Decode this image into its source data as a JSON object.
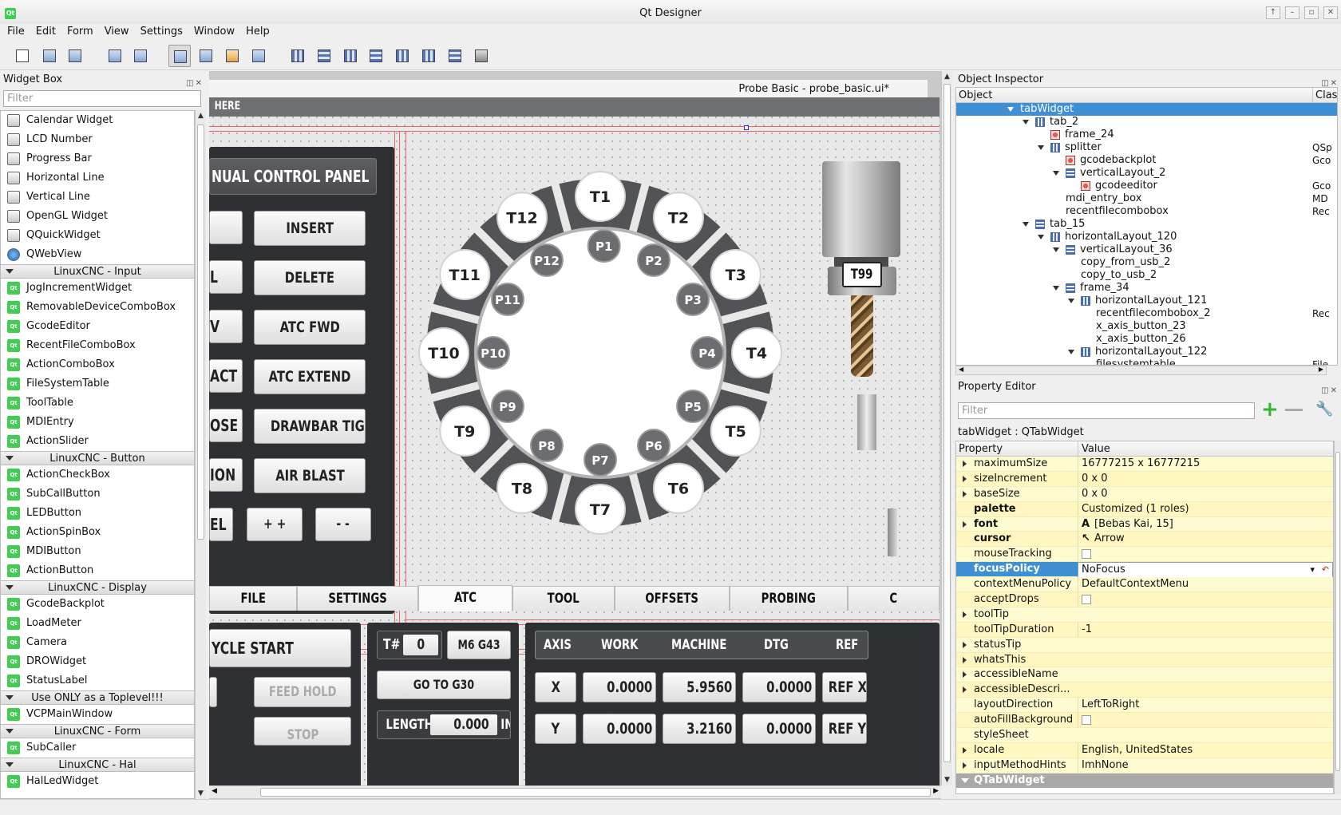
{
  "window": {
    "title": "Qt Designer"
  },
  "menu": [
    "File",
    "Edit",
    "Form",
    "View",
    "Settings",
    "Window",
    "Help"
  ],
  "widget_box": {
    "title": "Widget Box",
    "filter_placeholder": "Filter",
    "entries": [
      {
        "type": "item",
        "label": "Calendar Widget",
        "icon": "calendar-icon"
      },
      {
        "type": "item",
        "label": "LCD Number",
        "icon": "lcd-icon"
      },
      {
        "type": "item",
        "label": "Progress Bar",
        "icon": "progress-bar-icon"
      },
      {
        "type": "item",
        "label": "Horizontal Line",
        "icon": "horizontal-line-icon"
      },
      {
        "type": "item",
        "label": "Vertical Line",
        "icon": "vertical-line-icon"
      },
      {
        "type": "item",
        "label": "OpenGL Widget",
        "icon": "opengl-icon"
      },
      {
        "type": "item",
        "label": "QQuickWidget",
        "icon": "quick-widget-icon"
      },
      {
        "type": "item",
        "label": "QWebView",
        "icon": "globe-icon"
      },
      {
        "type": "category",
        "label": "LinuxCNC - Input"
      },
      {
        "type": "item",
        "label": "JogIncrementWidget",
        "icon": "qt-icon"
      },
      {
        "type": "item",
        "label": "RemovableDeviceComboBox",
        "icon": "qt-icon"
      },
      {
        "type": "item",
        "label": "GcodeEditor",
        "icon": "qt-icon"
      },
      {
        "type": "item",
        "label": "RecentFileComboBox",
        "icon": "qt-icon"
      },
      {
        "type": "item",
        "label": "ActionComboBox",
        "icon": "qt-icon"
      },
      {
        "type": "item",
        "label": "FileSystemTable",
        "icon": "qt-icon"
      },
      {
        "type": "item",
        "label": "ToolTable",
        "icon": "qt-icon"
      },
      {
        "type": "item",
        "label": "MDIEntry",
        "icon": "qt-icon"
      },
      {
        "type": "item",
        "label": "ActionSlider",
        "icon": "qt-icon"
      },
      {
        "type": "category",
        "label": "LinuxCNC - Button"
      },
      {
        "type": "item",
        "label": "ActionCheckBox",
        "icon": "qt-icon"
      },
      {
        "type": "item",
        "label": "SubCallButton",
        "icon": "qt-icon"
      },
      {
        "type": "item",
        "label": "LEDButton",
        "icon": "qt-icon"
      },
      {
        "type": "item",
        "label": "ActionSpinBox",
        "icon": "qt-icon"
      },
      {
        "type": "item",
        "label": "MDIButton",
        "icon": "qt-icon"
      },
      {
        "type": "item",
        "label": "ActionButton",
        "icon": "qt-icon"
      },
      {
        "type": "category",
        "label": "LinuxCNC - Display"
      },
      {
        "type": "item",
        "label": "GcodeBackplot",
        "icon": "qt-icon"
      },
      {
        "type": "item",
        "label": "LoadMeter",
        "icon": "qt-icon"
      },
      {
        "type": "item",
        "label": "Camera",
        "icon": "qt-icon"
      },
      {
        "type": "item",
        "label": "DROWidget",
        "icon": "qt-icon"
      },
      {
        "type": "item",
        "label": "StatusLabel",
        "icon": "qt-icon"
      },
      {
        "type": "category",
        "label": "Use ONLY as a Toplevel!!!"
      },
      {
        "type": "item",
        "label": "VCPMainWindow",
        "icon": "qt-icon"
      },
      {
        "type": "category",
        "label": "LinuxCNC - Form"
      },
      {
        "type": "item",
        "label": "SubCaller",
        "icon": "qt-icon"
      },
      {
        "type": "category",
        "label": "LinuxCNC - Hal"
      },
      {
        "type": "item",
        "label": "HalLedWidget",
        "icon": "qt-icon"
      }
    ]
  },
  "form": {
    "title": "Probe Basic - probe_basic.ui*",
    "header_strip": "HERE",
    "manual_panel_title": "NUAL CONTROL PANEL",
    "left_buttons": [
      "",
      "L",
      "V",
      "ACT",
      "OSE",
      "ION",
      "EL"
    ],
    "right_buttons": [
      "INSERT",
      "DELETE",
      "ATC FWD",
      "ATC EXTEND",
      "DRAWBAR TIGHT",
      "AIR BLAST"
    ],
    "small_buttons": [
      "+ +",
      "- -"
    ],
    "carousel_outer": [
      "T1",
      "T2",
      "T3",
      "T4",
      "T5",
      "T6",
      "T7",
      "T8",
      "T9",
      "T10",
      "T11",
      "T12"
    ],
    "carousel_inner": [
      "P1",
      "P2",
      "P3",
      "P4",
      "P5",
      "P6",
      "P7",
      "P8",
      "P9",
      "P10",
      "P11",
      "P12"
    ],
    "spindle_tool": "T99",
    "tabs": [
      "FILE",
      "SETTINGS",
      "ATC",
      "TOOL",
      "OFFSETS",
      "PROBING",
      "C"
    ],
    "selected_tab": "ATC",
    "cycle_start": "YCLE START",
    "feed_hold": "FEED HOLD",
    "stop": "STOP",
    "tool_hash_label": "T#",
    "tool_number": "0",
    "m6_g43": "M6 G43",
    "go_to_g30": "GO TO G30",
    "length_label": "LENGTH",
    "length_value": "0.000",
    "length_unit": "IN",
    "dro_headers": [
      "AXIS",
      "WORK",
      "MACHINE",
      "DTG",
      "REF"
    ],
    "dro_rows": [
      {
        "axis": "X",
        "work": "0.0000",
        "machine": "5.9560",
        "dtg": "0.0000",
        "ref": "REF X"
      },
      {
        "axis": "Y",
        "work": "0.0000",
        "machine": "3.2160",
        "dtg": "0.0000",
        "ref": "REF Y"
      }
    ]
  },
  "object_inspector": {
    "title": "Object Inspector",
    "col_object": "Object",
    "col_class": "Clas",
    "rows": [
      {
        "name": "tabWidget",
        "cls": "",
        "depth": 0,
        "exp": true,
        "sel": true,
        "icon": "tab"
      },
      {
        "name": "tab_2",
        "cls": "",
        "depth": 1,
        "exp": true,
        "icon": "h"
      },
      {
        "name": "frame_24",
        "cls": "",
        "depth": 2,
        "exp": false,
        "icon": "w"
      },
      {
        "name": "splitter",
        "cls": "QSp",
        "depth": 2,
        "exp": true,
        "icon": "h"
      },
      {
        "name": "gcodebackplot",
        "cls": "Gco",
        "depth": 3,
        "exp": false,
        "icon": "w"
      },
      {
        "name": "verticalLayout_2",
        "cls": "",
        "depth": 3,
        "exp": true,
        "icon": "v"
      },
      {
        "name": "gcodeeditor",
        "cls": "Gco",
        "depth": 4,
        "exp": false,
        "icon": "w"
      },
      {
        "name": "mdi_entry_box",
        "cls": "MD",
        "depth": 3,
        "exp": false,
        "icon": ""
      },
      {
        "name": "recentfilecombobox",
        "cls": "Rec",
        "depth": 3,
        "exp": false,
        "icon": ""
      },
      {
        "name": "tab_15",
        "cls": "",
        "depth": 1,
        "exp": true,
        "icon": "v"
      },
      {
        "name": "horizontalLayout_120",
        "cls": "",
        "depth": 2,
        "exp": true,
        "icon": "h"
      },
      {
        "name": "verticalLayout_36",
        "cls": "",
        "depth": 3,
        "exp": true,
        "icon": "v"
      },
      {
        "name": "copy_from_usb_2",
        "cls": "",
        "depth": 4,
        "exp": false,
        "icon": ""
      },
      {
        "name": "copy_to_usb_2",
        "cls": "",
        "depth": 4,
        "exp": false,
        "icon": ""
      },
      {
        "name": "frame_34",
        "cls": "",
        "depth": 3,
        "exp": true,
        "icon": "v"
      },
      {
        "name": "horizontalLayout_121",
        "cls": "",
        "depth": 4,
        "exp": true,
        "icon": "h"
      },
      {
        "name": "recentfilecombobox_2",
        "cls": "Rec",
        "depth": 5,
        "exp": false,
        "icon": ""
      },
      {
        "name": "x_axis_button_23",
        "cls": "",
        "depth": 5,
        "exp": false,
        "icon": ""
      },
      {
        "name": "x_axis_button_26",
        "cls": "",
        "depth": 5,
        "exp": false,
        "icon": ""
      },
      {
        "name": "horizontalLayout_122",
        "cls": "",
        "depth": 4,
        "exp": true,
        "icon": "h"
      },
      {
        "name": "filesystemtable",
        "cls": "File",
        "depth": 5,
        "exp": false,
        "icon": ""
      }
    ]
  },
  "property_editor": {
    "title": "Property Editor",
    "filter_placeholder": "Filter",
    "object_class": "tabWidget : QTabWidget",
    "col_property": "Property",
    "col_value": "Value",
    "rows": [
      {
        "name": "maximumSize",
        "value": "16777215 x 16777215",
        "expand": true
      },
      {
        "name": "sizeIncrement",
        "value": "0 x 0",
        "expand": true
      },
      {
        "name": "baseSize",
        "value": "0 x 0",
        "expand": true
      },
      {
        "name": "palette",
        "value": "Customized (1 roles)",
        "bold": true
      },
      {
        "name": "font",
        "value": "[Bebas Kai, 15]",
        "bold": true,
        "expand": true,
        "icon": "font-icon"
      },
      {
        "name": "cursor",
        "value": "Arrow",
        "bold": true,
        "icon": "arrow-cursor-icon"
      },
      {
        "name": "mouseTracking",
        "value": "",
        "check": true
      },
      {
        "name": "focusPolicy",
        "value": "NoFocus",
        "bold": true,
        "selected": true,
        "combo": true
      },
      {
        "name": "contextMenuPolicy",
        "value": "DefaultContextMenu"
      },
      {
        "name": "acceptDrops",
        "value": "",
        "check": true
      },
      {
        "name": "toolTip",
        "value": "",
        "expand": true
      },
      {
        "name": "toolTipDuration",
        "value": "-1"
      },
      {
        "name": "statusTip",
        "value": "",
        "expand": true
      },
      {
        "name": "whatsThis",
        "value": "",
        "expand": true
      },
      {
        "name": "accessibleName",
        "value": "",
        "expand": true
      },
      {
        "name": "accessibleDescri...",
        "value": "",
        "expand": true
      },
      {
        "name": "layoutDirection",
        "value": "LeftToRight"
      },
      {
        "name": "autoFillBackground",
        "value": "",
        "check": true
      },
      {
        "name": "styleSheet",
        "value": "",
        "expand": false
      },
      {
        "name": "locale",
        "value": "English, UnitedStates",
        "expand": true
      },
      {
        "name": "inputMethodHints",
        "value": "ImhNone",
        "expand": true
      }
    ],
    "section": "QTabWidget"
  },
  "colors": {
    "selection": "#3e8fd4",
    "property_bg": "#fffbd0",
    "dark_panel": "#2f3033",
    "tool_pocket": "#555659",
    "qt_green": "#41cd52"
  }
}
